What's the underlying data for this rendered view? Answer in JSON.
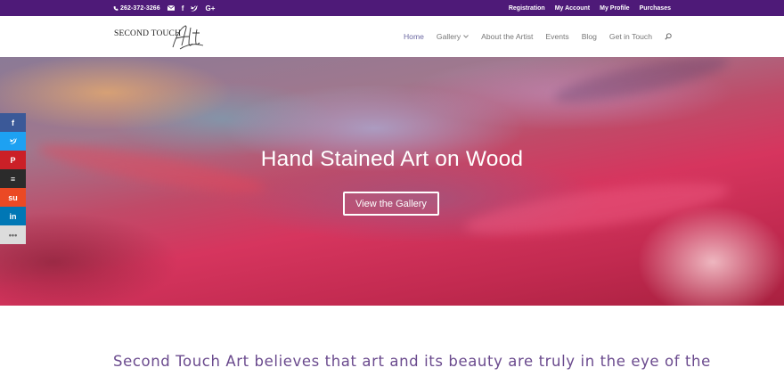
{
  "topbar": {
    "phone": "262-372-3266",
    "icons": [
      "phone-icon",
      "email-icon",
      "facebook-icon",
      "twitter-icon",
      "google-plus-icon"
    ],
    "links": [
      "Registration",
      "My Account",
      "My Profile",
      "Purchases"
    ]
  },
  "header": {
    "logo_text": "SECOND TOUCH",
    "logo_script": "Art",
    "nav": [
      {
        "label": "Home",
        "active": true
      },
      {
        "label": "Gallery",
        "has_dropdown": true
      },
      {
        "label": "About the Artist"
      },
      {
        "label": "Events"
      },
      {
        "label": "Blog"
      },
      {
        "label": "Get in Touch"
      }
    ]
  },
  "hero": {
    "title": "Hand Stained Art on Wood",
    "button": "View the Gallery"
  },
  "social_sidebar": [
    {
      "name": "facebook",
      "glyph": "f",
      "color": "#3b5998"
    },
    {
      "name": "twitter",
      "glyph": "t",
      "color": "#1da1f2"
    },
    {
      "name": "pinterest",
      "glyph": "P",
      "color": "#cb2027"
    },
    {
      "name": "buffer",
      "glyph": "≡",
      "color": "#2b2b2b"
    },
    {
      "name": "stumbleupon",
      "glyph": "su",
      "color": "#eb4924"
    },
    {
      "name": "linkedin",
      "glyph": "in",
      "color": "#0077b5"
    },
    {
      "name": "more",
      "glyph": "•••",
      "color": "#dcdcdc"
    }
  ],
  "intro": "Second Touch Art believes that art and its beauty are truly in the eye of the",
  "colors": {
    "topbar": "#4e1a78",
    "nav_active": "#6d6aa3",
    "intro_text": "#6b4b8e"
  }
}
